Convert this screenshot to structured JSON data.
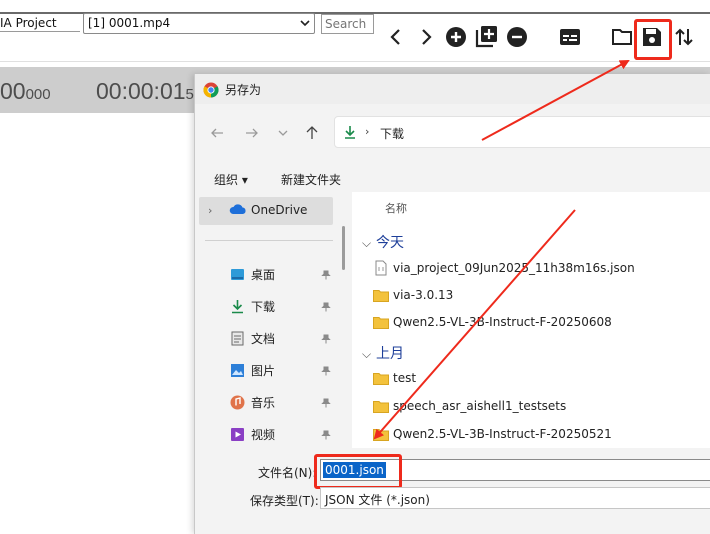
{
  "toolbar": {
    "project_name": "IA Project",
    "file_select_value": "[1] 0001.mp4",
    "search_placeholder": "Search",
    "icons": [
      "chevron-left",
      "chevron-right",
      "add-circle",
      "add-multiple",
      "remove-circle",
      "subtitles",
      "folder-open",
      "save",
      "sort"
    ]
  },
  "timeline": {
    "time_left_main": "00",
    "time_left_small": "000",
    "time_mid_main": "00:00:01",
    "time_mid_small": "5"
  },
  "dialog": {
    "title": "另存为",
    "address": "下载",
    "organize_label": "组织 ▾",
    "new_folder_label": "新建文件夹",
    "nav_items": [
      {
        "label": "OneDrive",
        "icon": "cloud-icon"
      },
      {
        "label": "桌面",
        "icon": "desktop-icon"
      },
      {
        "label": "下载",
        "icon": "download-icon"
      },
      {
        "label": "文档",
        "icon": "document-icon"
      },
      {
        "label": "图片",
        "icon": "picture-icon"
      },
      {
        "label": "音乐",
        "icon": "music-icon"
      },
      {
        "label": "视频",
        "icon": "video-icon"
      }
    ],
    "column_name": "名称",
    "groups": [
      {
        "label": "今天",
        "files": [
          {
            "name": "via_project_09Jun2025_11h38m16s.json",
            "type": "json"
          },
          {
            "name": "via-3.0.13",
            "type": "folder"
          },
          {
            "name": "Qwen2.5-VL-3B-Instruct-F-20250608",
            "type": "folder"
          }
        ]
      },
      {
        "label": "上月",
        "files": [
          {
            "name": "test",
            "type": "folder"
          },
          {
            "name": "speech_asr_aishell1_testsets",
            "type": "folder"
          },
          {
            "name": "Qwen2.5-VL-3B-Instruct-F-20250521",
            "type": "folder"
          }
        ]
      }
    ],
    "filename_label": "文件名(N):",
    "filename_value": "0001.json",
    "filetype_label": "保存类型(T):",
    "filetype_value": "JSON 文件 (*.json)"
  },
  "colors": {
    "highlight": "#ee2a1c",
    "selection": "#0a64c8",
    "group_header": "#1e3f9a"
  }
}
